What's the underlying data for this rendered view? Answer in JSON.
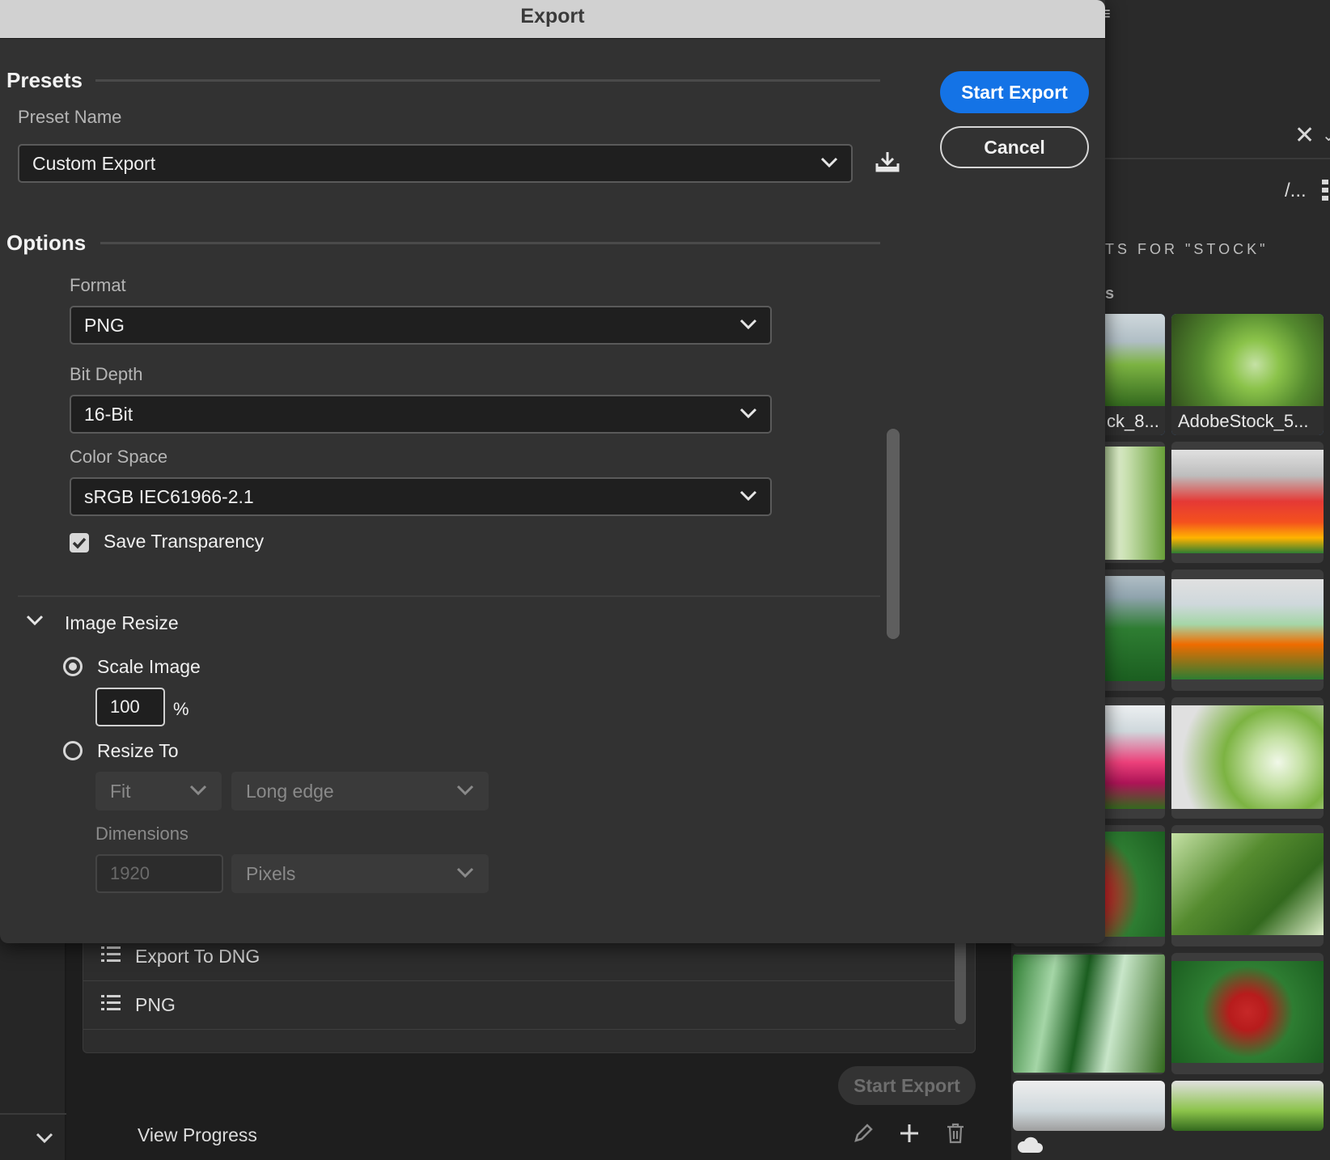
{
  "dialog": {
    "title": "Export",
    "presets": {
      "heading": "Presets",
      "preset_name_label": "Preset Name",
      "preset_value": "Custom Export"
    },
    "buttons": {
      "start_export": "Start Export",
      "cancel": "Cancel"
    },
    "options": {
      "heading": "Options",
      "format_label": "Format",
      "format_value": "PNG",
      "bit_depth_label": "Bit Depth",
      "bit_depth_value": "16-Bit",
      "color_space_label": "Color Space",
      "color_space_value": "sRGB IEC61966-2.1",
      "save_transparency_label": "Save Transparency",
      "save_transparency_checked": true
    },
    "image_resize": {
      "heading": "Image Resize",
      "scale_image_label": "Scale Image",
      "scale_value": "100",
      "scale_unit": "%",
      "resize_to_label": "Resize To",
      "fit_value": "Fit",
      "edge_value": "Long edge",
      "dimensions_label": "Dimensions",
      "dimensions_value": "1920",
      "units_value": "Pixels"
    }
  },
  "background_panel": {
    "preset_list": [
      "Export To DNG",
      "PNG"
    ],
    "start_export": "Start Export",
    "view_progress": "View Progress"
  },
  "library": {
    "results_header": "TS FOR \"STOCK\"",
    "section_suffix": "s",
    "path_text": "/...",
    "thumb_captions": [
      "ck_8...",
      "AdobeStock_5..."
    ]
  },
  "colors": {
    "accent": "#1473e6",
    "dialog_bg": "#323232",
    "titlebar_bg": "#d1d1d1"
  },
  "icons": [
    "menu-icon",
    "close-icon",
    "chevron-down-icon",
    "download-icon",
    "checkmark-icon",
    "list-icon",
    "pencil-icon",
    "plus-icon",
    "trash-icon",
    "cloud-icon"
  ]
}
